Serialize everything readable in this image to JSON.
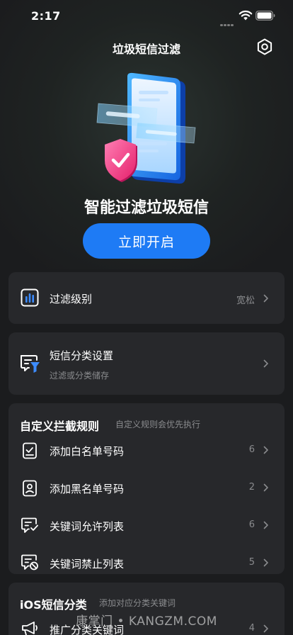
{
  "status_bar": {
    "time": "2:17"
  },
  "header": {
    "title": "垃圾短信过滤"
  },
  "hero": {
    "headline": "智能过滤垃圾短信",
    "button_label": "立即开启"
  },
  "filter_level": {
    "label": "过滤级别",
    "value": "宽松"
  },
  "sms_category": {
    "label": "短信分类设置",
    "sublabel": "过滤或分类储存"
  },
  "custom_rules": {
    "title": "自定义拦截规则",
    "hint": "自定义规则会优先执行",
    "items": [
      {
        "label": "添加白名单号码",
        "count": "6",
        "icon": "whitelist-icon"
      },
      {
        "label": "添加黑名单号码",
        "count": "2",
        "icon": "blacklist-icon"
      },
      {
        "label": "关键词允许列表",
        "count": "6",
        "icon": "keyword-allow-icon"
      },
      {
        "label": "关键词禁止列表",
        "count": "5",
        "icon": "keyword-block-icon"
      }
    ]
  },
  "ios_category": {
    "title": "iOS短信分类",
    "hint": "添加对应分类关键词",
    "items": [
      {
        "label": "推广分类关键词",
        "count": "4",
        "icon": "megaphone-icon"
      }
    ]
  },
  "watermark": "康掌门 • KANGZM.COM",
  "colors": {
    "accent": "#1e7bf5",
    "card": "#27282b",
    "background": "#1b1c1e",
    "secondary_text": "#8a8b8e"
  }
}
